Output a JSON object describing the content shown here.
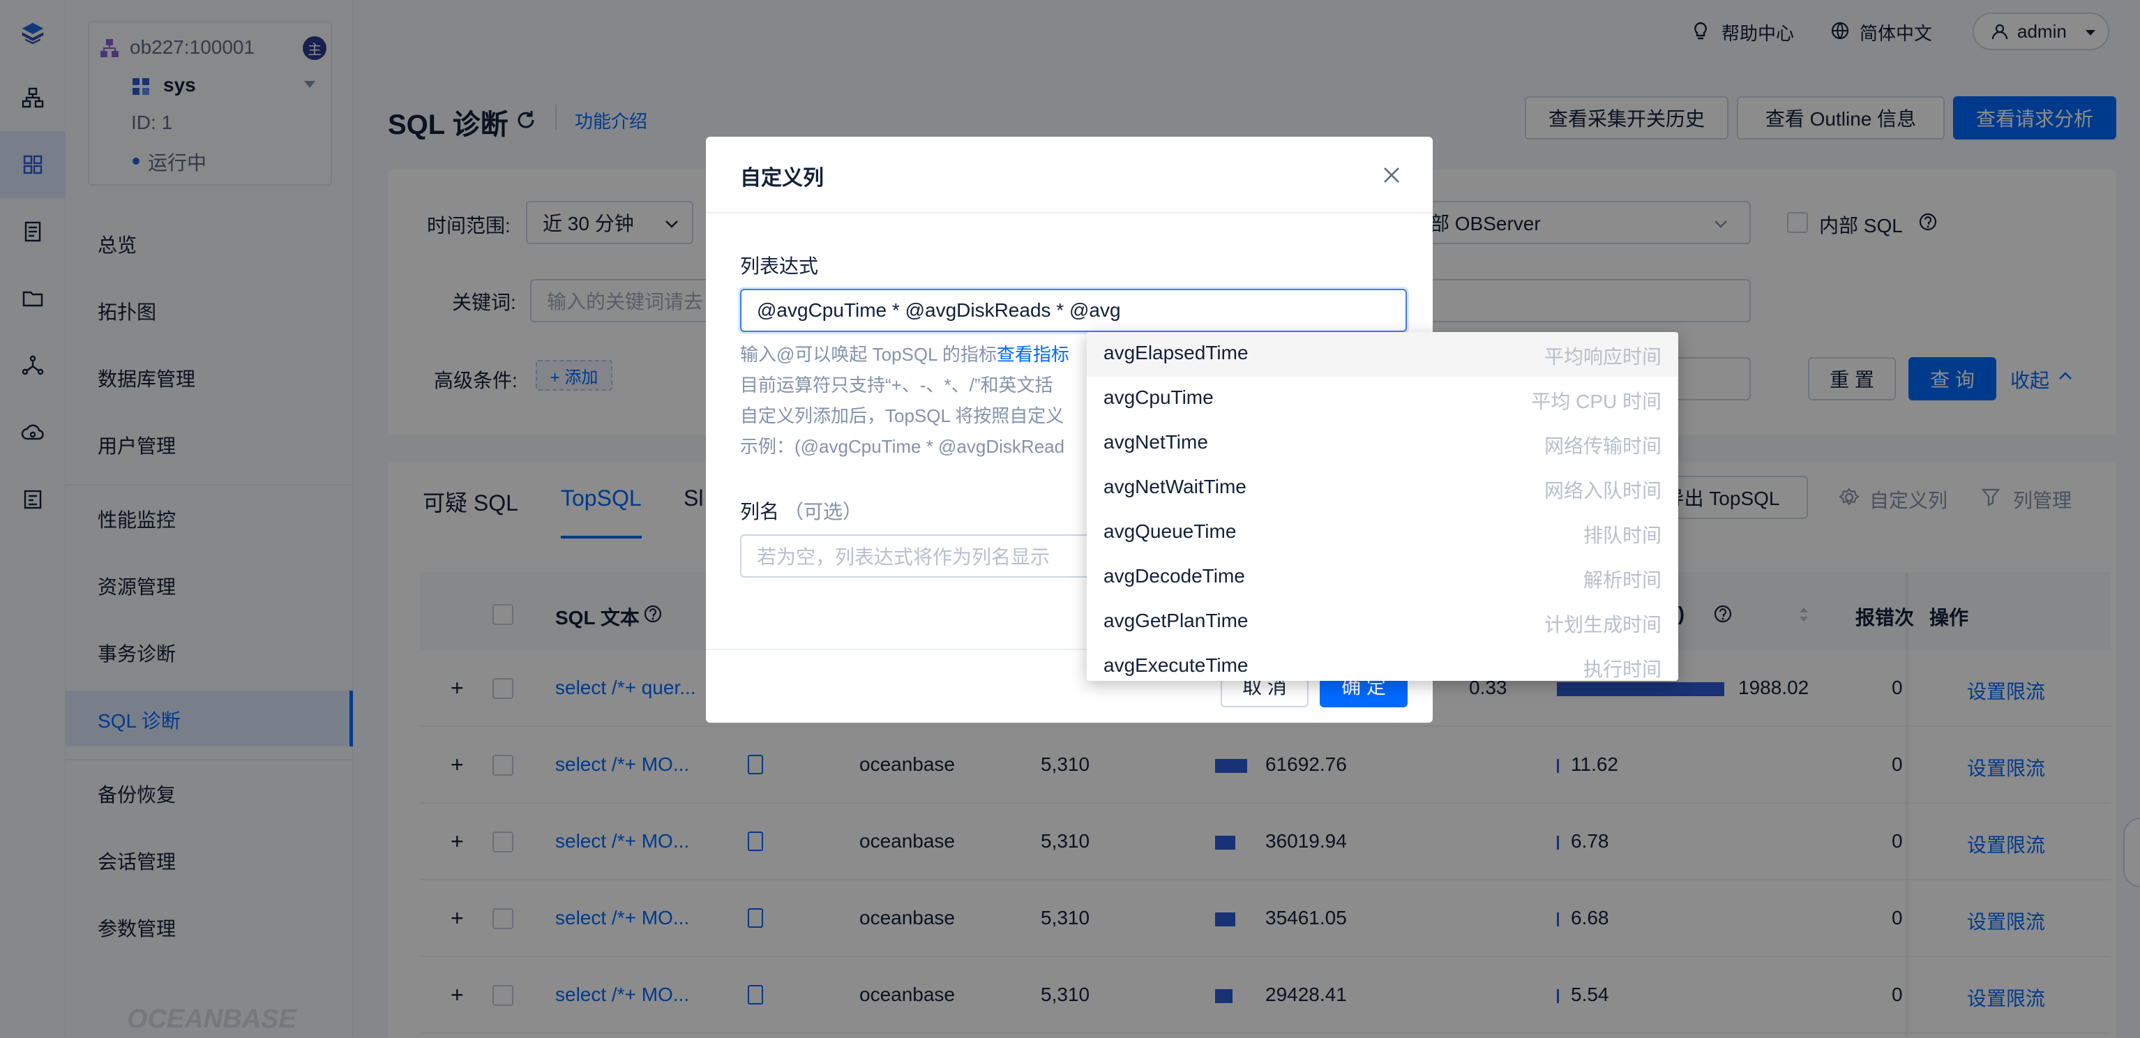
{
  "header": {
    "help": "帮助中心",
    "lang": "简体中文",
    "user": "admin"
  },
  "cluster": {
    "name": "ob227:100001",
    "badge": "主",
    "tenant": "sys",
    "id": "ID: 1",
    "status": "运行中"
  },
  "nav": [
    "总览",
    "拓扑图",
    "数据库管理",
    "用户管理",
    "性能监控",
    "资源管理",
    "事务诊断",
    "SQL 诊断",
    "备份恢复",
    "会话管理",
    "参数管理"
  ],
  "brand": "OCEANBASE",
  "page": {
    "title": "SQL 诊断",
    "intro": "功能介绍",
    "btn_history": "查看采集开关历史",
    "btn_outline": "查看 Outline 信息",
    "btn_analysis": "查看请求分析"
  },
  "filters": {
    "time_label": "时间范围:",
    "time_value": "近 30 分钟",
    "server_value": "部 OBServer",
    "internal_sql": "内部 SQL",
    "keyword_label": "关键词:",
    "keyword_placeholder": "输入的关键词请去",
    "adv_label": "高级条件:",
    "add": "+ 添加",
    "reset": "重 置",
    "query": "查 询",
    "collapse": "收起"
  },
  "tabs": [
    "可疑 SQL",
    "TopSQL",
    "Sl"
  ],
  "table_actions": {
    "export": "导出 TopSQL",
    "custom_column": "自定义列",
    "column_manage": "列管理"
  },
  "columns": {
    "sql_text": "SQL 文本",
    "unit": "s)",
    "error": "报错次",
    "action": "操作"
  },
  "rows": [
    {
      "sql": "select /*+ quer...",
      "db": "",
      "count": "",
      "v1": "",
      "v1_tail": "0.33",
      "v1_frac": 0,
      "v2": "1988.02",
      "v2_frac": 1.0,
      "err": "0",
      "action": "设置限流"
    },
    {
      "sql": "select /*+ MO...",
      "db": "oceanbase",
      "count": "5,310",
      "v1": "61692.76",
      "v1_frac": 1.0,
      "v2": "11.62",
      "v2_frac": 0.006,
      "err": "0",
      "action": "设置限流"
    },
    {
      "sql": "select /*+ MO...",
      "db": "oceanbase",
      "count": "5,310",
      "v1": "36019.94",
      "v1_frac": 0.58,
      "v2": "6.78",
      "v2_frac": 0.003,
      "err": "0",
      "action": "设置限流"
    },
    {
      "sql": "select /*+ MO...",
      "db": "oceanbase",
      "count": "5,310",
      "v1": "35461.05",
      "v1_frac": 0.57,
      "v2": "6.68",
      "v2_frac": 0.003,
      "err": "0",
      "action": "设置限流"
    },
    {
      "sql": "select /*+ MO...",
      "db": "oceanbase",
      "count": "5,310",
      "v1": "29428.41",
      "v1_frac": 0.48,
      "v2": "5.54",
      "v2_frac": 0.003,
      "err": "0",
      "action": "设置限流"
    }
  ],
  "modal": {
    "title": "自定义列",
    "expr_label": "列表达式",
    "expr_value": "@avgCpuTime * @avgDiskReads * @avg",
    "help1_a": "输入@可以唤起 TopSQL 的指标",
    "help1_link": "查看指标",
    "help2": "目前运算符只支持“+、-、*、/”和英文括",
    "help3": "自定义列添加后，TopSQL 将按照自定义",
    "help4": "示例：(@avgCpuTime * @avgDiskRead",
    "name_label": "列名",
    "name_optional": "（可选）",
    "name_placeholder": "若为空，列表达式将作为列名显示",
    "cancel": "取 消",
    "ok": "确 定"
  },
  "suggestions": [
    {
      "name": "avgElapsedTime",
      "desc": "平均响应时间"
    },
    {
      "name": "avgCpuTime",
      "desc": "平均 CPU 时间"
    },
    {
      "name": "avgNetTime",
      "desc": "网络传输时间"
    },
    {
      "name": "avgNetWaitTime",
      "desc": "网络入队时间"
    },
    {
      "name": "avgQueueTime",
      "desc": "排队时间"
    },
    {
      "name": "avgDecodeTime",
      "desc": "解析时间"
    },
    {
      "name": "avgGetPlanTime",
      "desc": "计划生成时间"
    },
    {
      "name": "avgExecuteTime",
      "desc": "执行时间"
    }
  ]
}
